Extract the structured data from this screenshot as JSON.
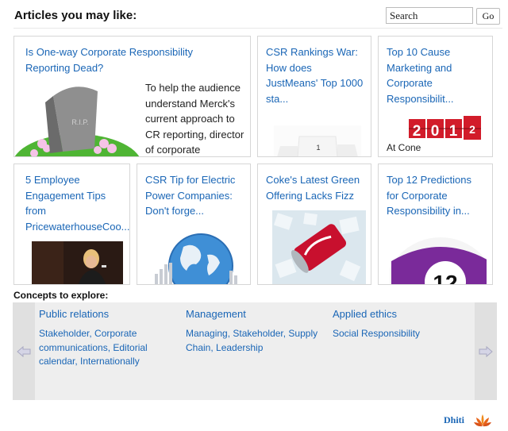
{
  "header": {
    "title": "Articles you may like:",
    "search_placeholder": "Search",
    "go_label": "Go"
  },
  "articles": [
    {
      "title_lines": [
        "Is One-way Corporate Responsibility",
        "Reporting Dead?"
      ],
      "snippet_lines": [
        "To help the audience",
        "understand Merck's",
        "current approach to",
        "CR reporting, director",
        "of corporate"
      ],
      "thumb_text": "R.I.P.",
      "thumb_icon": "gravestone-icon"
    },
    {
      "title_lines": [
        "CSR Rankings War:",
        "How does",
        "JustMeans' Top 1000",
        "sta..."
      ],
      "thumb_text": "1",
      "thumb_icon": "podium-icon"
    },
    {
      "title_lines": [
        "Top 10 Cause",
        "Marketing and",
        "Corporate",
        "Responsibilit..."
      ],
      "thumb_text": "2012",
      "caption": "At Cone",
      "thumb_icon": "year-counter-icon"
    },
    {
      "title_lines": [
        "5 Employee",
        "Engagement Tips",
        "from",
        "PricewaterhouseCoo..."
      ],
      "thumb_icon": "speaker-photo-icon"
    },
    {
      "title_lines": [
        "CSR Tip for Electric",
        "Power Companies:",
        "Don't forge..."
      ],
      "thumb_icon": "globe-icon"
    },
    {
      "title_lines": [
        "Coke's Latest Green",
        "Offering Lacks Fizz"
      ],
      "thumb_icon": "soda-can-ice-icon"
    },
    {
      "title_lines": [
        "Top 12 Predictions",
        "for Corporate",
        "Responsibility in..."
      ],
      "thumb_text": "12",
      "thumb_icon": "billiard-ball-icon"
    }
  ],
  "concepts": {
    "label": "Concepts to explore:",
    "columns": [
      {
        "heading": "Public relations",
        "links": "Stakeholder, Corporate communications, Editorial calendar, Internationally"
      },
      {
        "heading": "Management",
        "links": "Managing, Stakeholder, Supply Chain, Leadership"
      },
      {
        "heading": "Applied ethics",
        "links": "Social Responsibility"
      }
    ],
    "left_arrow_icon": "arrow-left-icon",
    "right_arrow_icon": "arrow-right-icon"
  },
  "brand": {
    "name": "Dhiti",
    "logo_icon": "lotus-logo-icon"
  },
  "colors": {
    "link": "#1a66b6",
    "card_border": "#d6d6d6",
    "panel_bg": "#eeeeee"
  }
}
